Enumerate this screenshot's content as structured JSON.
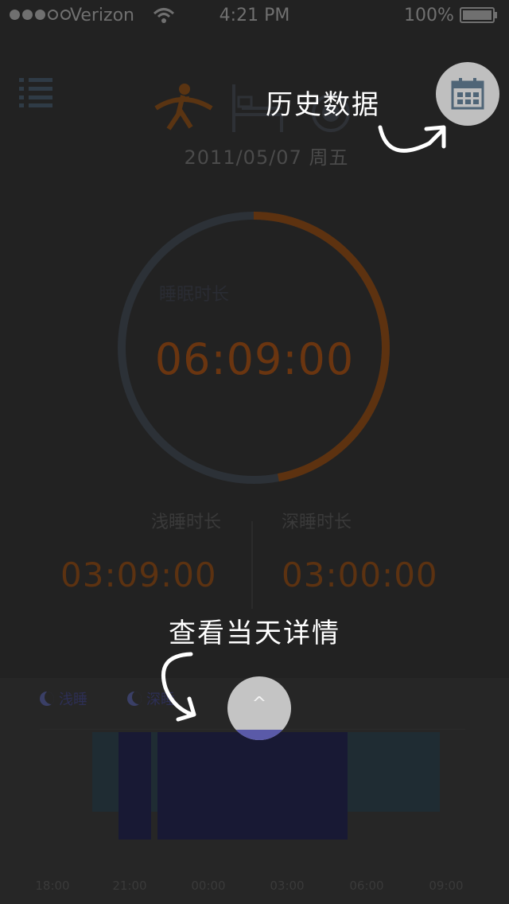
{
  "status_bar": {
    "carrier": "Verizon",
    "time": "4:21 PM",
    "battery": "100%"
  },
  "header": {
    "date": "2011/05/07 周五",
    "icons": [
      "menu-icon",
      "run-icon",
      "bed-icon",
      "moon-icon",
      "calendar-icon"
    ]
  },
  "summary": {
    "total_label": "睡眠时长",
    "total_time": "06:09:00",
    "light_label": "浅睡时长",
    "light_time": "03:09:00",
    "deep_label": "深睡时长",
    "deep_time": "03:00:00",
    "ring_fraction_orange": 0.47
  },
  "hints": {
    "history": "历史数据",
    "details": "查看当天详情"
  },
  "chart": {
    "legend": [
      "浅睡",
      "深睡"
    ],
    "ticks": [
      "18:00",
      "21:00",
      "00:00",
      "03:00",
      "06:00",
      "09:00"
    ],
    "up_label": "^"
  },
  "colors": {
    "accent_orange": "#6a3510",
    "light_sleep": "#1f2c33",
    "deep_sleep": "#181934",
    "overlay": "#222222"
  },
  "chart_data": {
    "type": "bar",
    "series": [
      {
        "name": "浅睡",
        "segments": [
          [
            "19:30",
            "20:30"
          ],
          [
            "21:45",
            "22:00"
          ],
          [
            "05:15",
            "08:45"
          ]
        ]
      },
      {
        "name": "深睡",
        "segments": [
          [
            "20:30",
            "21:45"
          ],
          [
            "22:00",
            "05:15"
          ]
        ]
      }
    ],
    "x_ticks": [
      "18:00",
      "21:00",
      "00:00",
      "03:00",
      "06:00",
      "09:00"
    ]
  }
}
